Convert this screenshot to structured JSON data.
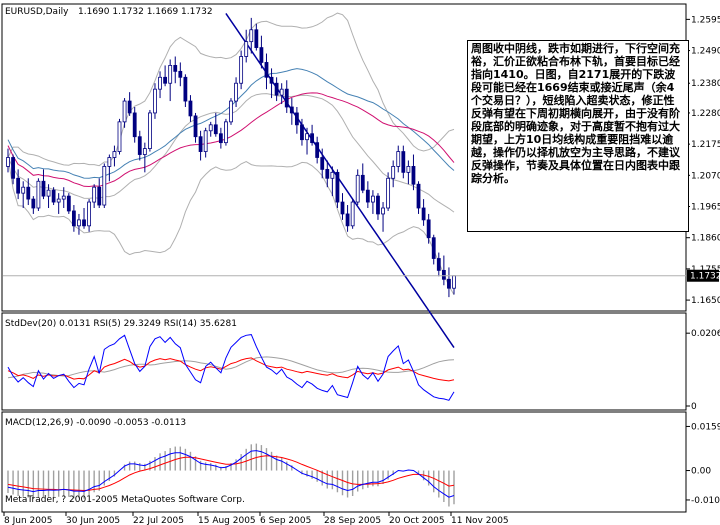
{
  "chart_data": [
    {
      "type": "candlestick",
      "panel": "price",
      "symbol_label": "EURUSD,Daily",
      "ohlc_label": "1.1690 1.1732 1.1669 1.1732",
      "current_price_label": "1.1732",
      "yticks": [
        "1.2595",
        "1.2490",
        "1.2380",
        "1.2280",
        "1.2175",
        "1.2070",
        "1.1965",
        "1.1860",
        "1.1755",
        "1.1650"
      ],
      "ylim": [
        1.162,
        1.264
      ],
      "colors": {
        "bull": "#ffffff",
        "bear": "#000080",
        "ma_fast": "#0000a0",
        "ma_mid": "#4682b4",
        "ma_slow": "#d01070",
        "bands": "#b0b0b0"
      },
      "candles": [
        [
          1.21,
          1.216,
          1.208,
          1.213
        ],
        [
          1.213,
          1.214,
          1.204,
          1.206
        ],
        [
          1.206,
          1.209,
          1.199,
          1.201
        ],
        [
          1.201,
          1.205,
          1.196,
          1.203
        ],
        [
          1.203,
          1.206,
          1.197,
          1.199
        ],
        [
          1.199,
          1.2,
          1.194,
          1.196
        ],
        [
          1.196,
          1.206,
          1.195,
          1.205
        ],
        [
          1.205,
          1.209,
          1.199,
          1.2
        ],
        [
          1.2,
          1.204,
          1.196,
          1.202
        ],
        [
          1.202,
          1.203,
          1.197,
          1.198
        ],
        [
          1.198,
          1.201,
          1.194,
          1.199
        ],
        [
          1.199,
          1.203,
          1.196,
          1.2
        ],
        [
          1.2,
          1.201,
          1.194,
          1.195
        ],
        [
          1.195,
          1.197,
          1.188,
          1.19
        ],
        [
          1.19,
          1.194,
          1.187,
          1.192
        ],
        [
          1.192,
          1.196,
          1.189,
          1.19
        ],
        [
          1.19,
          1.199,
          1.188,
          1.198
        ],
        [
          1.198,
          1.204,
          1.196,
          1.203
        ],
        [
          1.203,
          1.206,
          1.196,
          1.197
        ],
        [
          1.197,
          1.211,
          1.196,
          1.21
        ],
        [
          1.21,
          1.214,
          1.205,
          1.213
        ],
        [
          1.213,
          1.217,
          1.21,
          1.215
        ],
        [
          1.215,
          1.226,
          1.214,
          1.225
        ],
        [
          1.225,
          1.233,
          1.223,
          1.232
        ],
        [
          1.232,
          1.235,
          1.227,
          1.228
        ],
        [
          1.228,
          1.23,
          1.218,
          1.22
        ],
        [
          1.22,
          1.222,
          1.212,
          1.214
        ],
        [
          1.214,
          1.218,
          1.208,
          1.216
        ],
        [
          1.216,
          1.229,
          1.215,
          1.228
        ],
        [
          1.228,
          1.238,
          1.226,
          1.236
        ],
        [
          1.236,
          1.242,
          1.233,
          1.24
        ],
        [
          1.24,
          1.244,
          1.237,
          1.238
        ],
        [
          1.238,
          1.246,
          1.232,
          1.244
        ],
        [
          1.244,
          1.247,
          1.238,
          1.242
        ],
        [
          1.242,
          1.245,
          1.237,
          1.24
        ],
        [
          1.24,
          1.241,
          1.23,
          1.232
        ],
        [
          1.232,
          1.234,
          1.225,
          1.227
        ],
        [
          1.227,
          1.228,
          1.218,
          1.22
        ],
        [
          1.22,
          1.222,
          1.212,
          1.215
        ],
        [
          1.215,
          1.223,
          1.213,
          1.222
        ],
        [
          1.222,
          1.225,
          1.22,
          1.224
        ],
        [
          1.224,
          1.228,
          1.22,
          1.221
        ],
        [
          1.221,
          1.223,
          1.216,
          1.218
        ],
        [
          1.218,
          1.226,
          1.217,
          1.225
        ],
        [
          1.225,
          1.233,
          1.224,
          1.232
        ],
        [
          1.232,
          1.24,
          1.23,
          1.238
        ],
        [
          1.238,
          1.249,
          1.236,
          1.247
        ],
        [
          1.247,
          1.256,
          1.245,
          1.252
        ],
        [
          1.252,
          1.26,
          1.248,
          1.256
        ],
        [
          1.256,
          1.258,
          1.249,
          1.25
        ],
        [
          1.25,
          1.254,
          1.243,
          1.245
        ],
        [
          1.245,
          1.248,
          1.236,
          1.24
        ],
        [
          1.24,
          1.243,
          1.233,
          1.238
        ],
        [
          1.238,
          1.24,
          1.232,
          1.234
        ],
        [
          1.234,
          1.238,
          1.231,
          1.236
        ],
        [
          1.236,
          1.239,
          1.228,
          1.23
        ],
        [
          1.23,
          1.233,
          1.224,
          1.228
        ],
        [
          1.228,
          1.23,
          1.221,
          1.224
        ],
        [
          1.224,
          1.226,
          1.217,
          1.219
        ],
        [
          1.219,
          1.223,
          1.214,
          1.221
        ],
        [
          1.221,
          1.224,
          1.217,
          1.218
        ],
        [
          1.218,
          1.22,
          1.211,
          1.213
        ],
        [
          1.213,
          1.216,
          1.206,
          1.209
        ],
        [
          1.209,
          1.212,
          1.203,
          1.206
        ],
        [
          1.206,
          1.21,
          1.2,
          1.208
        ],
        [
          1.208,
          1.209,
          1.196,
          1.198
        ],
        [
          1.198,
          1.201,
          1.192,
          1.194
        ],
        [
          1.194,
          1.197,
          1.188,
          1.19
        ],
        [
          1.19,
          1.199,
          1.189,
          1.198
        ],
        [
          1.198,
          1.209,
          1.197,
          1.207
        ],
        [
          1.207,
          1.211,
          1.201,
          1.202
        ],
        [
          1.202,
          1.205,
          1.196,
          1.198
        ],
        [
          1.198,
          1.202,
          1.194,
          1.2
        ],
        [
          1.2,
          1.201,
          1.192,
          1.194
        ],
        [
          1.194,
          1.198,
          1.188,
          1.196
        ],
        [
          1.196,
          1.208,
          1.195,
          1.206
        ],
        [
          1.206,
          1.212,
          1.203,
          1.21
        ],
        [
          1.21,
          1.217,
          1.208,
          1.215
        ],
        [
          1.215,
          1.217,
          1.206,
          1.208
        ],
        [
          1.208,
          1.212,
          1.204,
          1.21
        ],
        [
          1.21,
          1.214,
          1.202,
          1.204
        ],
        [
          1.204,
          1.205,
          1.194,
          1.196
        ],
        [
          1.196,
          1.199,
          1.19,
          1.192
        ],
        [
          1.192,
          1.194,
          1.184,
          1.186
        ],
        [
          1.186,
          1.187,
          1.177,
          1.179
        ],
        [
          1.179,
          1.181,
          1.173,
          1.175
        ],
        [
          1.175,
          1.18,
          1.17,
          1.172
        ],
        [
          1.172,
          1.176,
          1.166,
          1.169
        ],
        [
          1.169,
          1.1732,
          1.1669,
          1.1732
        ]
      ]
    },
    {
      "type": "line",
      "panel": "stddev_rsi",
      "label": "StdDev(20) 0.0131  RSI(5) 29.3249  RSI(14) 35.6281",
      "yticks": [
        "0.0206",
        "0"
      ],
      "ylim": [
        0,
        0.0215
      ],
      "colors": {
        "stddev": "#a0a0a0",
        "rsi5": "#0000ff",
        "rsi14": "#ff0000"
      },
      "stddev": [
        0.008,
        0.0082,
        0.0085,
        0.009,
        0.0092,
        0.0095,
        0.0094,
        0.0093,
        0.009,
        0.0088,
        0.0086,
        0.0085,
        0.0086,
        0.009,
        0.0094,
        0.0097,
        0.0099,
        0.01,
        0.0098,
        0.0096,
        0.0099,
        0.0103,
        0.0108,
        0.0112,
        0.0115,
        0.0117,
        0.0118,
        0.0118,
        0.0116,
        0.0117,
        0.012,
        0.0122,
        0.0124,
        0.0126,
        0.0127,
        0.0128,
        0.0127,
        0.0125,
        0.0122,
        0.012,
        0.0117,
        0.0112,
        0.0108,
        0.0104,
        0.0106,
        0.0111,
        0.0118,
        0.0125,
        0.0131,
        0.0136,
        0.0138,
        0.0139,
        0.0138,
        0.0136,
        0.0134,
        0.0131,
        0.0127,
        0.0122,
        0.0117,
        0.0112,
        0.0107,
        0.0102,
        0.0099,
        0.0096,
        0.0094,
        0.0094,
        0.0096,
        0.01,
        0.0104,
        0.0106,
        0.0107,
        0.0106,
        0.0104,
        0.0101,
        0.0098,
        0.0096,
        0.0095,
        0.0095,
        0.0097,
        0.0099,
        0.01,
        0.0103,
        0.0108,
        0.0114,
        0.012,
        0.0125,
        0.0128,
        0.013,
        0.0131
      ],
      "rsi5": [
        0.011,
        0.0085,
        0.0068,
        0.008,
        0.0066,
        0.0055,
        0.01,
        0.0076,
        0.0092,
        0.0078,
        0.0086,
        0.009,
        0.007,
        0.0052,
        0.0064,
        0.006,
        0.0105,
        0.014,
        0.0092,
        0.016,
        0.017,
        0.0176,
        0.019,
        0.02,
        0.016,
        0.012,
        0.0098,
        0.0112,
        0.0168,
        0.019,
        0.0196,
        0.018,
        0.0194,
        0.0176,
        0.0165,
        0.0118,
        0.0096,
        0.0074,
        0.0066,
        0.0112,
        0.0124,
        0.0108,
        0.0094,
        0.0136,
        0.0166,
        0.018,
        0.0194,
        0.02,
        0.0202,
        0.0168,
        0.0138,
        0.011,
        0.0102,
        0.009,
        0.0104,
        0.0082,
        0.0074,
        0.0062,
        0.0052,
        0.007,
        0.0062,
        0.005,
        0.0044,
        0.004,
        0.0058,
        0.0032,
        0.0028,
        0.0024,
        0.0066,
        0.0112,
        0.0088,
        0.0076,
        0.0094,
        0.007,
        0.009,
        0.014,
        0.0156,
        0.017,
        0.012,
        0.013,
        0.0098,
        0.006,
        0.0046,
        0.0036,
        0.0026,
        0.0022,
        0.002,
        0.0016,
        0.004
      ],
      "rsi14": [
        0.01,
        0.0094,
        0.0086,
        0.0088,
        0.0084,
        0.0078,
        0.0088,
        0.0084,
        0.0088,
        0.0085,
        0.0086,
        0.0088,
        0.0082,
        0.0076,
        0.0078,
        0.0077,
        0.0088,
        0.01,
        0.0094,
        0.011,
        0.0116,
        0.012,
        0.0126,
        0.0132,
        0.0126,
        0.0116,
        0.011,
        0.0113,
        0.0124,
        0.013,
        0.0134,
        0.0131,
        0.0134,
        0.013,
        0.0127,
        0.0117,
        0.011,
        0.0104,
        0.01,
        0.0108,
        0.0111,
        0.0108,
        0.0104,
        0.0112,
        0.012,
        0.0124,
        0.013,
        0.0134,
        0.0136,
        0.0128,
        0.0121,
        0.0114,
        0.0111,
        0.0108,
        0.011,
        0.0104,
        0.0101,
        0.0097,
        0.0094,
        0.0098,
        0.0095,
        0.0092,
        0.0089,
        0.0087,
        0.0091,
        0.0085,
        0.0082,
        0.008,
        0.0088,
        0.0098,
        0.0094,
        0.0091,
        0.0094,
        0.009,
        0.0093,
        0.0102,
        0.0106,
        0.011,
        0.0102,
        0.0104,
        0.0098,
        0.009,
        0.0086,
        0.0082,
        0.0078,
        0.0075,
        0.0073,
        0.0071,
        0.0074
      ]
    },
    {
      "type": "bar+line",
      "panel": "macd",
      "label": "MACD(12,26,9) -0.0090 -0.0053 -0.0113",
      "yticks": [
        "0.0159",
        "0.00",
        "-0.0106"
      ],
      "ylim": [
        -0.0135,
        0.0175
      ],
      "colors": {
        "histogram": "#a0a0a0",
        "main": "#0000ff",
        "signal": "#ff0000"
      },
      "main": [
        -0.006,
        -0.0064,
        -0.0068,
        -0.007,
        -0.0072,
        -0.0076,
        -0.0072,
        -0.0072,
        -0.007,
        -0.0071,
        -0.007,
        -0.0068,
        -0.007,
        -0.0074,
        -0.0074,
        -0.0075,
        -0.0068,
        -0.0058,
        -0.0054,
        -0.004,
        -0.0028,
        -0.0016,
        0.0,
        0.0016,
        0.0024,
        0.0024,
        0.002,
        0.0018,
        0.0026,
        0.0036,
        0.0046,
        0.0052,
        0.006,
        0.0064,
        0.0064,
        0.0058,
        0.005,
        0.0038,
        0.0026,
        0.0022,
        0.002,
        0.0016,
        0.001,
        0.0012,
        0.002,
        0.003,
        0.0044,
        0.0058,
        0.007,
        0.0072,
        0.0068,
        0.006,
        0.005,
        0.004,
        0.0034,
        0.0024,
        0.0014,
        0.0002,
        -0.001,
        -0.0016,
        -0.0022,
        -0.003,
        -0.004,
        -0.0048,
        -0.005,
        -0.0058,
        -0.0066,
        -0.0072,
        -0.0068,
        -0.0056,
        -0.005,
        -0.0046,
        -0.0042,
        -0.0042,
        -0.0036,
        -0.0024,
        -0.0012,
        0.0,
        -0.0002,
        0.0002,
        0.0,
        -0.0012,
        -0.0026,
        -0.004,
        -0.0058,
        -0.0072,
        -0.0084,
        -0.0096,
        -0.009
      ],
      "signal": [
        -0.005,
        -0.0053,
        -0.0056,
        -0.0059,
        -0.0062,
        -0.0065,
        -0.0066,
        -0.0067,
        -0.0068,
        -0.0068,
        -0.0069,
        -0.0068,
        -0.0069,
        -0.007,
        -0.0071,
        -0.0072,
        -0.0071,
        -0.0068,
        -0.0066,
        -0.006,
        -0.0054,
        -0.0046,
        -0.0037,
        -0.0026,
        -0.0016,
        -0.0008,
        -0.0002,
        0.0002,
        0.0007,
        0.0013,
        0.002,
        0.0027,
        0.0033,
        0.004,
        0.0045,
        0.0048,
        0.0048,
        0.0046,
        0.0042,
        0.0038,
        0.0034,
        0.003,
        0.0026,
        0.0023,
        0.0023,
        0.0024,
        0.0028,
        0.0034,
        0.0041,
        0.0047,
        0.0051,
        0.0053,
        0.0052,
        0.005,
        0.0047,
        0.0042,
        0.0037,
        0.003,
        0.0022,
        0.0015,
        0.0008,
        0.0001,
        -0.0007,
        -0.0015,
        -0.0022,
        -0.0029,
        -0.0036,
        -0.0043,
        -0.0048,
        -0.005,
        -0.005,
        -0.0049,
        -0.0048,
        -0.0047,
        -0.0045,
        -0.0041,
        -0.0035,
        -0.0028,
        -0.0023,
        -0.0018,
        -0.0014,
        -0.0014,
        -0.0016,
        -0.0021,
        -0.0028,
        -0.0037,
        -0.0046,
        -0.0056,
        -0.0053
      ]
    }
  ],
  "x_labels": [
    "8 Jun 2005",
    "30 Jun 2005",
    "22 Jul 2005",
    "15 Aug 2005",
    "6 Sep 2005",
    "28 Sep 2005",
    "20 Oct 2005",
    "11 Nov 2005"
  ],
  "copyright": "MetaTrader, ? 2001-2005 MetaQuotes Software Corp.",
  "note_text": "周图收中阴线，跌市如期进行，下行空间充裕，汇价正欲粘合布林下轨，首要目标已经指向1410。日图，自2171展开的下跌波段可能已经在1669结束或接近尾声（余4个交易日？），短线陷入超卖状态，修正性反弹有望在下周初期横向展开，由于没有阶段底部的明确迹象，对于高度暂不抱有过大期望，上方10日均线构成重要阻挡难以逾越，操作仍以择机放空为主导思路，不建议反弹操作，节奏及具体位置在日内图表中跟踪分析。"
}
